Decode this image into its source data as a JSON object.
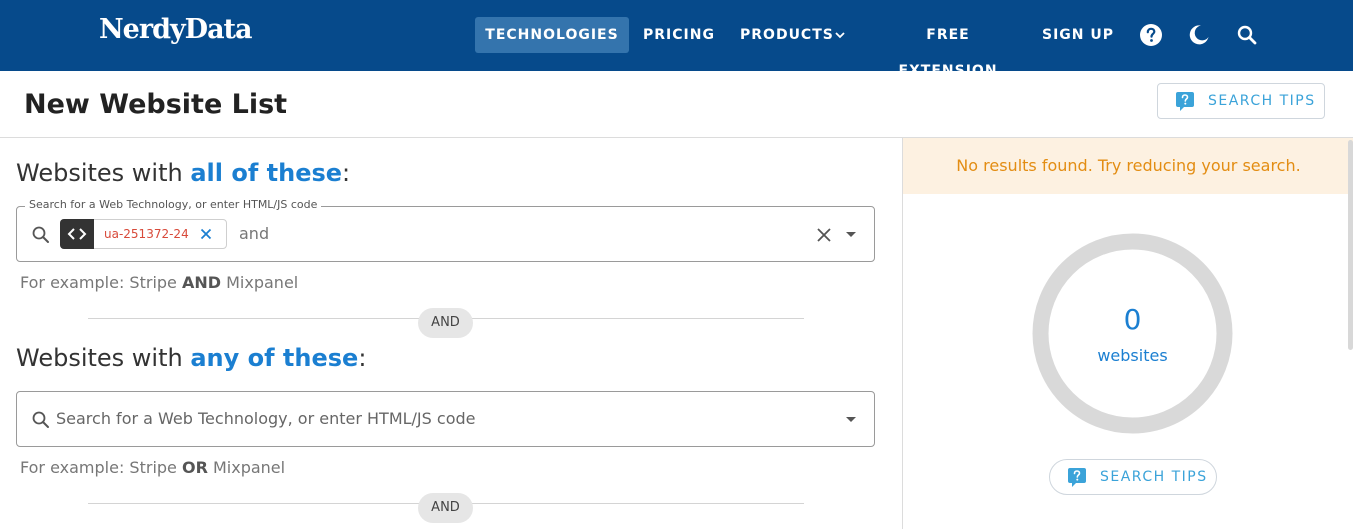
{
  "nav": {
    "logo": "NerdyData",
    "items": [
      {
        "label": "TECHNOLOGIES",
        "active": true
      },
      {
        "label": "PRICING"
      },
      {
        "label": "PRODUCTS"
      },
      {
        "label": "FREE EXTENSION"
      },
      {
        "label": "SIGN UP"
      }
    ],
    "icons": [
      "help-icon",
      "dark-mode-moon-icon",
      "search-icon"
    ]
  },
  "header": {
    "title": "New Website List",
    "tips_label": "SEARCH TIPS"
  },
  "all_section": {
    "prefix": "Websites with ",
    "emph": "all of these",
    "suffix": ":",
    "legend": "Search for a Web Technology, or enter HTML/JS code",
    "chip_text": "ua-251372-24",
    "joiner": "and",
    "example_prefix": "For example: Stripe ",
    "example_op": "AND",
    "example_suffix": " Mixpanel"
  },
  "separator_label": "AND",
  "any_section": {
    "prefix": "Websites with ",
    "emph": "any of these",
    "suffix": ":",
    "placeholder": "Search for a Web Technology, or enter HTML/JS code",
    "example_prefix": "For example: Stripe ",
    "example_op": "OR",
    "example_suffix": " Mixpanel"
  },
  "results": {
    "alert": "No results found. Try reducing your search.",
    "count": "0",
    "count_label": "websites",
    "tips_label": "SEARCH TIPS"
  },
  "colors": {
    "nav_bg": "#064a8b",
    "accent": "#1b7fd1",
    "warning": "#e38d13"
  }
}
